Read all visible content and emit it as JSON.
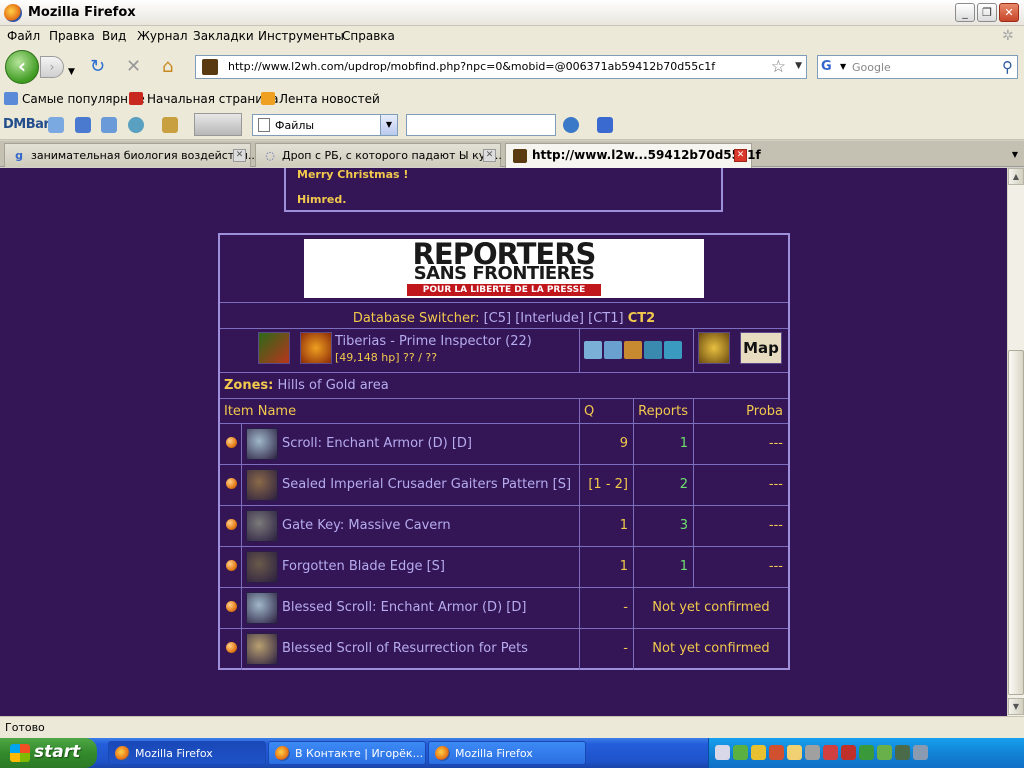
{
  "window": {
    "title": "Mozilla Firefox"
  },
  "menu": [
    "Файл",
    "Правка",
    "Вид",
    "Журнал",
    "Закладки",
    "Инструменты",
    "Справка"
  ],
  "nav": {
    "url": "http://www.l2wh.com/updrop/mobfind.php?npc=0&mobid=@006371ab59412b70d55c1f",
    "search_placeholder": "Google",
    "search_engine": "G"
  },
  "bookmarks": [
    "Самые популярные",
    "Начальная страница",
    "Лента новостей"
  ],
  "dmbar": {
    "logo": "DMBar",
    "files_label": "Файлы"
  },
  "tabs": [
    {
      "label": "занимательная биология воздействи...",
      "active": false,
      "fav": "g"
    },
    {
      "label": "Дроп с РБ, с которого падают Ы кус...",
      "active": false,
      "fav": "◌"
    },
    {
      "label": "http://www.l2w...59412b70d55c1f",
      "active": true,
      "fav": ""
    }
  ],
  "page": {
    "prev_msg": {
      "line1": "Merry Christmas !",
      "line2": "Himred."
    },
    "banner": {
      "line1": "REPORTERS",
      "line2": "SANS FRONTIERES",
      "line3": "POUR LA LIBERTE DE LA PRESSE"
    },
    "db_switcher": {
      "label": "Database Switcher:",
      "options": [
        "[C5]",
        "[Interlude]",
        "[CT1]"
      ],
      "current": "CT2"
    },
    "mob": {
      "name": "Tiberias - Prime Inspector (22)",
      "hp": "[49,148 hp] ?? / ??",
      "map_label": "Map"
    },
    "zones": {
      "label": "Zones:",
      "value": "Hills of Gold area"
    },
    "columns": {
      "item": "Item Name",
      "q": "Q",
      "reports": "Reports",
      "proba": "Proba"
    },
    "items": [
      {
        "name": "Scroll: Enchant Armor (D) [D]",
        "q": "9",
        "reports": "1",
        "proba": "---",
        "confirmed": true,
        "icon_color": "#9fb8c8"
      },
      {
        "name": "Sealed Imperial Crusader Gaiters Pattern [S]",
        "q": "[1 - 2]",
        "reports": "2",
        "proba": "---",
        "confirmed": true,
        "icon_color": "#8a6a48"
      },
      {
        "name": "Gate Key: Massive Cavern",
        "q": "1",
        "reports": "3",
        "proba": "---",
        "confirmed": true,
        "icon_color": "#7a7a7a"
      },
      {
        "name": "Forgotten Blade Edge [S]",
        "q": "1",
        "reports": "1",
        "proba": "---",
        "confirmed": true,
        "icon_color": "#6a5a4a"
      },
      {
        "name": "Blessed Scroll: Enchant Armor (D) [D]",
        "q": "-",
        "note": "Not yet confirmed",
        "confirmed": false,
        "icon_color": "#9fb8c8"
      },
      {
        "name": "Blessed Scroll of Resurrection for Pets",
        "q": "-",
        "note": "Not yet confirmed",
        "confirmed": false,
        "icon_color": "#b8a070"
      }
    ]
  },
  "status": "Готово",
  "taskbar": {
    "start": "start",
    "tasks": [
      {
        "label": "Mozilla Firefox",
        "active": true
      },
      {
        "label": "В Контакте | Игорёк...",
        "active": false
      },
      {
        "label": "Mozilla Firefox",
        "active": false
      }
    ]
  },
  "colors": {
    "page_bg": "#341657",
    "border": "#9d8fd9",
    "gold": "#f2c94c",
    "lavender": "#b6acef",
    "green": "#6ee06e"
  }
}
